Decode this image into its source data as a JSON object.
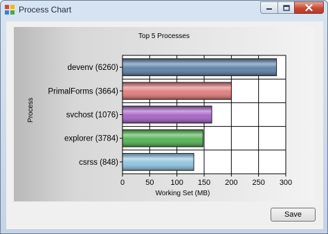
{
  "window": {
    "title": "Process Chart"
  },
  "buttons": {
    "save_label": "Save"
  },
  "colors": {
    "bar_outline": "#1e1e1e",
    "grid": "#000000"
  },
  "chart_data": {
    "type": "bar",
    "orientation": "horizontal",
    "title": "Top 5 Processes",
    "xlabel": "Working Set (MB)",
    "ylabel": "Process",
    "xlim": [
      0,
      300
    ],
    "xticks": [
      0,
      50,
      100,
      150,
      200,
      250,
      300
    ],
    "grid": true,
    "categories": [
      "devenv (6260)",
      "PrimalForms (3664)",
      "svchost (1076)",
      "explorer (3784)",
      "csrss (848)"
    ],
    "values": [
      283,
      200,
      164,
      148,
      131
    ],
    "bar_colors": [
      "#5a7fa7",
      "#e17a7a",
      "#a65fc6",
      "#4fb14f",
      "#8ec3e0"
    ]
  }
}
